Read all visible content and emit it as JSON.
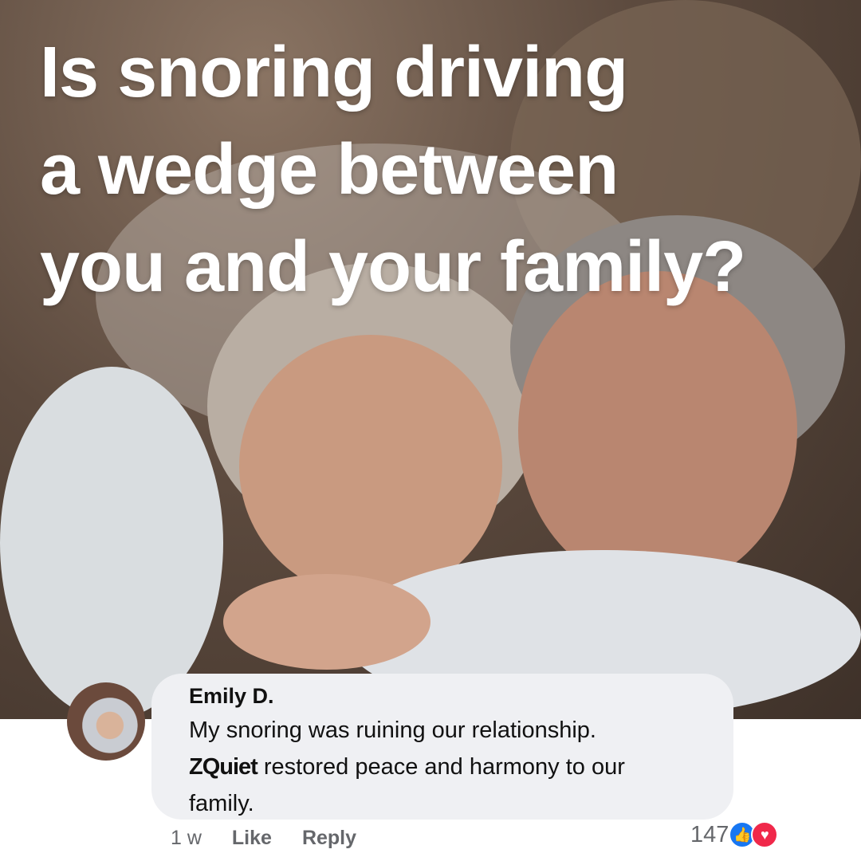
{
  "headline": {
    "lines": [
      "Is snoring driving",
      "a wedge between",
      "you and your family?"
    ]
  },
  "comment": {
    "author": "Emily D.",
    "text_line1": "My snoring was ruining our relationship.",
    "brand": "ZQuiet",
    "text_line2_rest": " restored peace and harmony to our",
    "text_line3": "family.",
    "time": "1 w",
    "like_label": "Like",
    "reply_label": "Reply",
    "reaction_count": "147",
    "reactions": [
      "like-icon",
      "love-icon"
    ],
    "colors": {
      "like": "#1877f2",
      "love": "#f0284a",
      "bubble": "#eff0f3"
    }
  }
}
